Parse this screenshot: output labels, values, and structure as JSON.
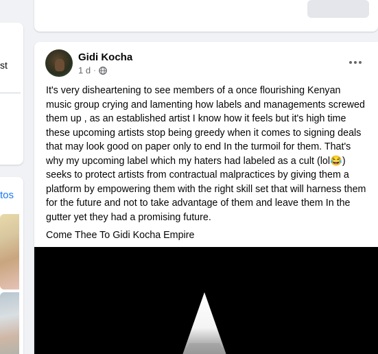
{
  "left_sidebar": {
    "top_fragment": "st",
    "bottom_fragment": "tos"
  },
  "post": {
    "author": "Gidi Kocha",
    "timestamp": "1 d",
    "audience_icon": "globe-icon",
    "more_icon": "more-horizontal-icon",
    "body": "It's very disheartening to see members of a once flourishing Kenyan music group  crying and lamenting how  labels and managements screwed them up , as an established artist I know how it feels but it's high time these upcoming  artists stop being greedy when it comes to signing deals that may look good on paper only to end In the turmoil for them. That's why my upcoming label which my haters had labeled as a cult (lol😂) seeks to protect  artists from contractual malpractices by giving them a platform by empowering them with the right skill set that will harness them for the future  and not to take advantage of them and leave them In the gutter yet they had a promising future.",
    "closing": "Come Thee To Gidi Kocha Empire"
  },
  "colors": {
    "page_background": "#f0f2f5",
    "card": "#ffffff",
    "secondary_text": "#65676b",
    "link": "#1877f2"
  }
}
